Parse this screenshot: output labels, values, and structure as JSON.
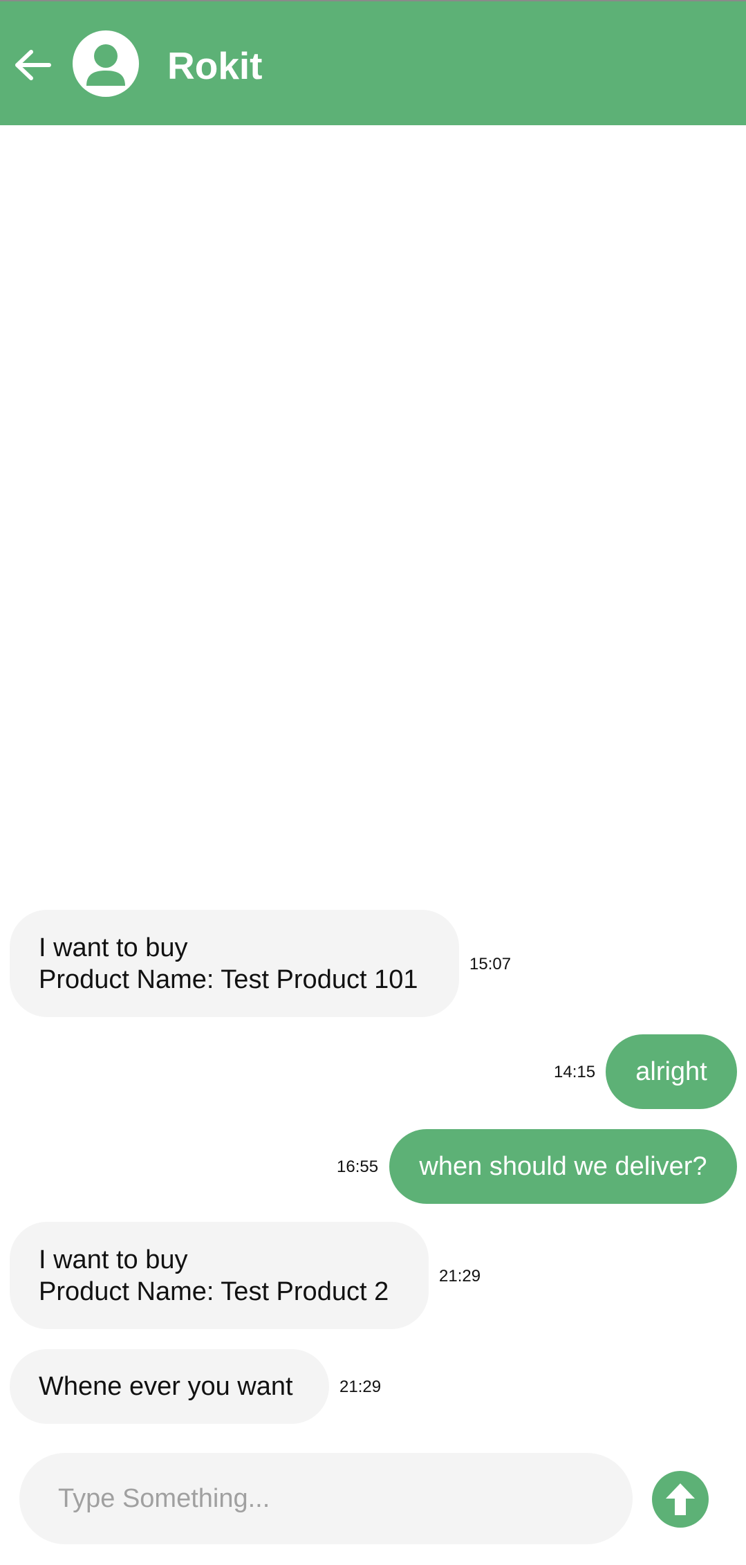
{
  "header": {
    "title": "Rokit",
    "back_icon": "arrow-left-icon",
    "avatar_icon": "person-icon",
    "color": "#5db176"
  },
  "messages": [
    {
      "direction": "incoming",
      "text": "I want to buy\nProduct Name: Test Product 101",
      "time": "15:07"
    },
    {
      "direction": "outgoing",
      "text": "alright",
      "time": "14:15"
    },
    {
      "direction": "outgoing",
      "text": "when should we deliver?",
      "time": "16:55"
    },
    {
      "direction": "incoming",
      "text": "I want to buy\nProduct Name: Test Product 2",
      "time": "21:29"
    },
    {
      "direction": "incoming",
      "text": "Whene ever you want",
      "time": "21:29"
    }
  ],
  "composer": {
    "placeholder": "Type Something...",
    "value": "",
    "send_icon": "arrow-up-icon"
  },
  "colors": {
    "accent": "#5db176",
    "incoming_bubble": "#f4f4f4",
    "outgoing_text": "#ffffff"
  }
}
